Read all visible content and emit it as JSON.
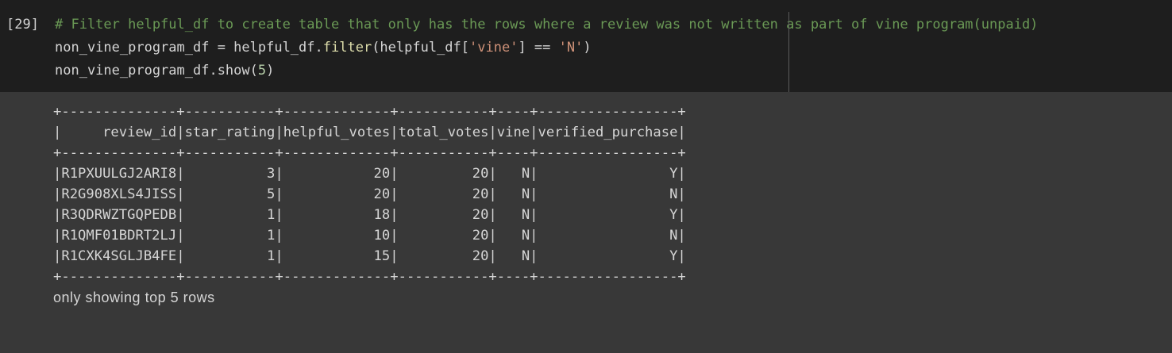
{
  "cell": {
    "execution_count": "[29]",
    "code_lines": [
      [
        {
          "text": "# Filter helpful_df to create table that only has the rows where a review was not written as part of vine program(unpaid)",
          "kind": "comment"
        }
      ],
      [
        {
          "text": "non_vine_program_df = helpful_df.",
          "kind": "plain"
        },
        {
          "text": "filter",
          "kind": "method"
        },
        {
          "text": "(helpful_df[",
          "kind": "plain"
        },
        {
          "text": "'vine'",
          "kind": "string"
        },
        {
          "text": "] == ",
          "kind": "plain"
        },
        {
          "text": "'N'",
          "kind": "string"
        },
        {
          "text": ")",
          "kind": "plain"
        }
      ],
      [
        {
          "text": "non_vine_program_df.show(",
          "kind": "plain"
        },
        {
          "text": "5",
          "kind": "number"
        },
        {
          "text": ")",
          "kind": "plain"
        }
      ]
    ]
  },
  "output": {
    "table_text": [
      "+--------------+-----------+-------------+-----------+----+-----------------+",
      "|     review_id|star_rating|helpful_votes|total_votes|vine|verified_purchase|",
      "+--------------+-----------+-------------+-----------+----+-----------------+",
      "|R1PXUULGJ2ARI8|          3|           20|         20|   N|                Y|",
      "|R2G908XLS4JISS|          5|           20|         20|   N|                N|",
      "|R3QDRWZTGQPEDB|          1|           18|         20|   N|                Y|",
      "|R1QMF01BDRT2LJ|          1|           10|         20|   N|                N|",
      "|R1CXK4SGLJB4FE|          1|           15|         20|   N|                Y|",
      "+--------------+-----------+-------------+-----------+----+-----------------+"
    ],
    "footer": "only showing top 5 rows"
  }
}
